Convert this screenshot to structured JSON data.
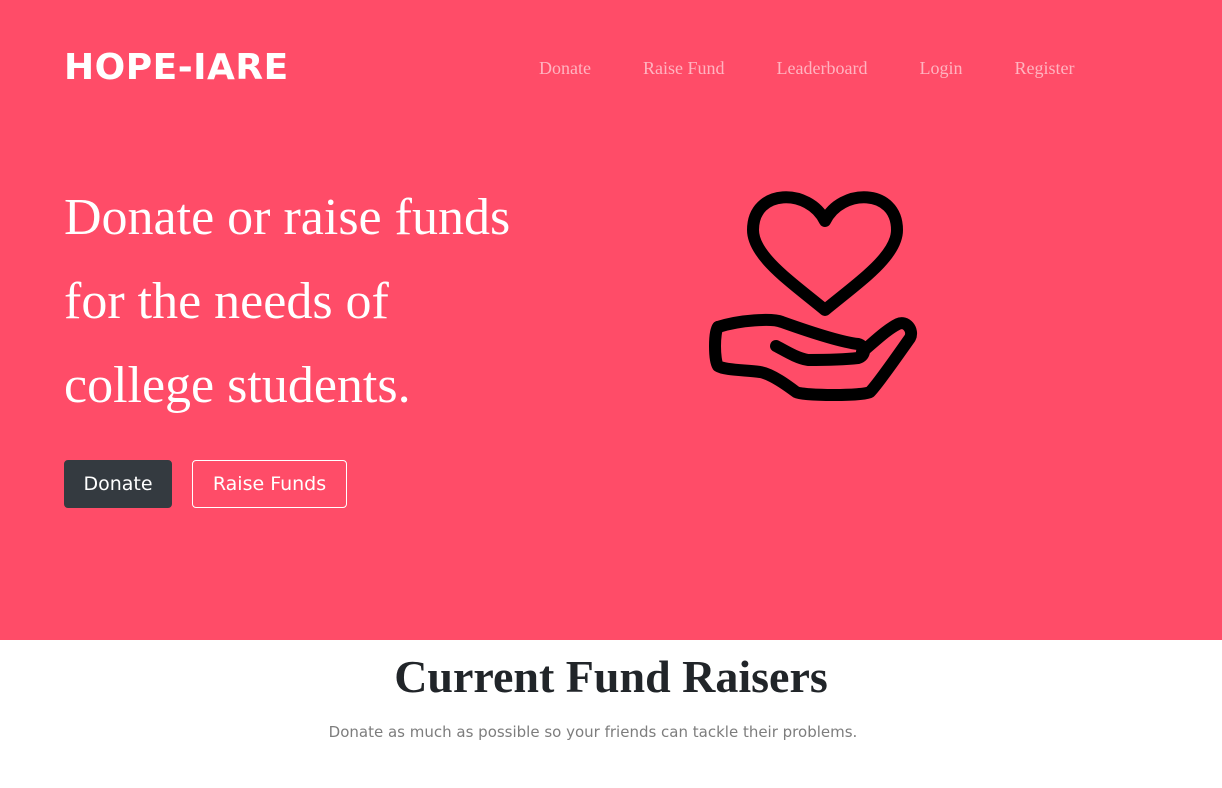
{
  "header": {
    "brand": "HOPE-IARE",
    "nav": [
      "Donate",
      "Raise Fund",
      "Leaderboard",
      "Login",
      "Register"
    ]
  },
  "hero": {
    "headline_lines": [
      "Donate or raise funds",
      "for the needs of",
      "college students."
    ],
    "primary_button": "Donate",
    "secondary_button": "Raise Funds",
    "icon": "hand-holding-heart-icon"
  },
  "section": {
    "title": "Current Fund Raisers",
    "subtitle": "Donate as much as possible so your friends can tackle their problems."
  },
  "colors": {
    "hero_background": "#ff4c68",
    "nav_link": "#ffb4c0",
    "primary_button": "#343a40",
    "title_text": "#212529",
    "subtitle_text": "#7d7d7d"
  }
}
